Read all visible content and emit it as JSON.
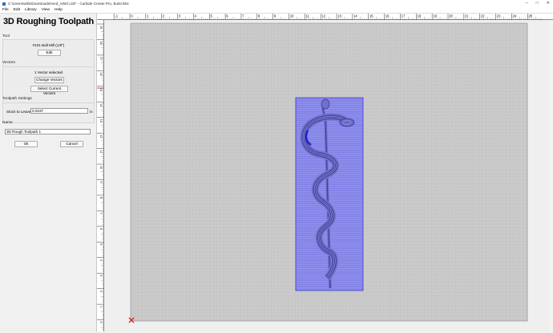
{
  "window": {
    "title": "C:\\Users\\willa\\Downloads\\med_relief.c2d* - Carbide Create Pro, Build 854",
    "app_icon": "carbide-create-icon",
    "controls": [
      "–",
      "□",
      "✕"
    ]
  },
  "menu": [
    "File",
    "Edit",
    "Library",
    "View",
    "Help"
  ],
  "panel": {
    "title": "3D Roughing Toolpath",
    "tool": {
      "section_label": "Tool",
      "tool_name": "#101 Ball Mill (1/8\")",
      "edit_label": "Edit"
    },
    "vectors": {
      "section_label": "Vectors",
      "status": "1 Vector selected",
      "change_label": "Change Vectors",
      "select_label": "Select Current Vectors"
    },
    "settings": {
      "section_label": "Toolpath Settings",
      "stock_label": "Stock to Leave",
      "stock_value": "0.0197",
      "unit": "in"
    },
    "name": {
      "section_label": "Name",
      "value": "3D Rough Toolpath 1"
    },
    "ok_label": "Ok",
    "cancel_label": "Cancel"
  },
  "ruler": {
    "top_labels": [
      "-1",
      "0",
      "1",
      "2",
      "3",
      "4",
      "5",
      "6",
      "7",
      "8",
      "9",
      "10",
      "11",
      "12",
      "13",
      "14",
      "15",
      "16",
      "17",
      "18",
      "19",
      "20",
      "21",
      "22",
      "23",
      "24",
      "25"
    ],
    "left_labels": [
      "19",
      "18",
      "17",
      "16",
      "15",
      "14",
      "13",
      "12",
      "11",
      "10",
      "9",
      "8",
      "7",
      "6",
      "5",
      "4",
      "3",
      "2",
      "1",
      "0"
    ]
  },
  "colors": {
    "stock": "#cacaca",
    "grid": "#b5b5b5",
    "toolpath_fill": "#9090ee",
    "toolpath_line": "#3333cc",
    "origin": "#e02020"
  }
}
